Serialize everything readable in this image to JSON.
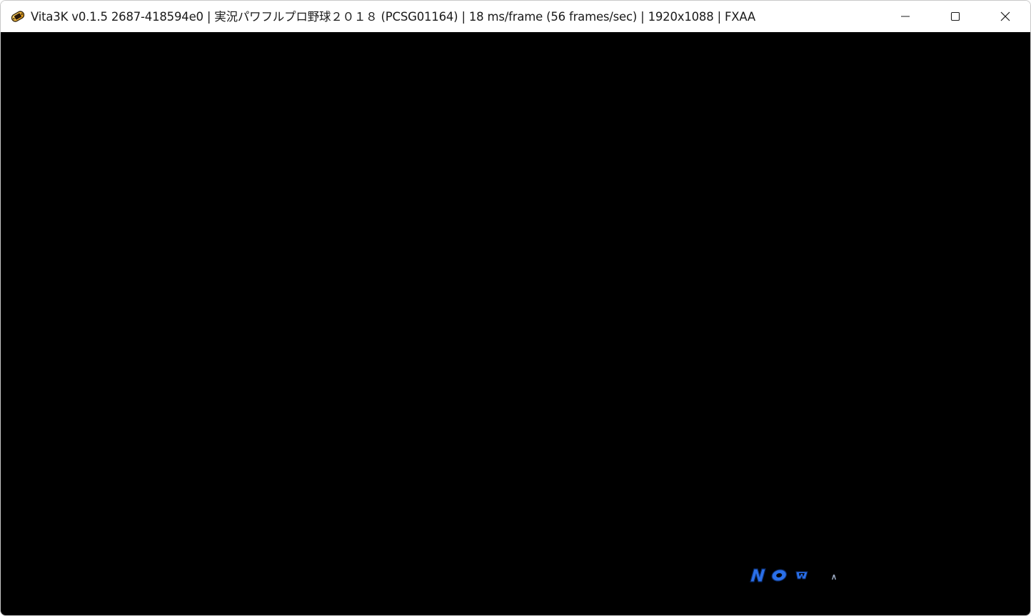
{
  "window": {
    "title": "Vita3K v0.1.5 2687-418594e0 | 実況パワフルプロ野球２０１８ (PCSG01164) | 18 ms/frame (56 frames/sec) | 1920x1088 | FXAA",
    "app_icon": "vita3k-icon",
    "controls": {
      "minimize_icon": "minimize-icon",
      "maximize_icon": "maximize-icon",
      "close_icon": "close-icon"
    }
  },
  "viewport": {
    "background": "#000000",
    "loading_logo_icon": "now-loading-logo-icon",
    "logo_color": "#2a6fe8"
  }
}
